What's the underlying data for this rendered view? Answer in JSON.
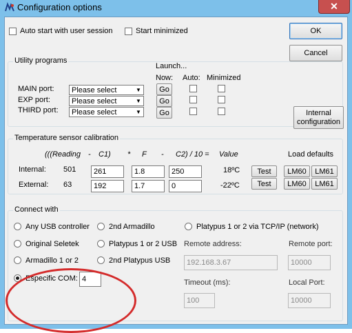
{
  "window": {
    "title": "Configuration options",
    "close_label": "✕"
  },
  "top": {
    "auto_start_label": "Auto start with user session",
    "start_min_label": "Start minimized"
  },
  "buttons": {
    "ok": "OK",
    "cancel": "Cancel",
    "internal_config": [
      "Internal",
      "configuration"
    ]
  },
  "utility": {
    "group_label": "Utility programs",
    "launch_label": "Launch...",
    "now_label": "Now:",
    "auto_label": "Auto:",
    "minimized_label": "Minimized",
    "go_label": "Go",
    "ports": [
      {
        "label": "MAIN port:",
        "value": "Please select"
      },
      {
        "label": "EXP port:",
        "value": "Please select"
      },
      {
        "label": "THIRD port:",
        "value": "Please select"
      }
    ]
  },
  "temperature": {
    "group_label": "Temperature sensor calibration",
    "formula": [
      "(((Reading",
      "-",
      "C1)",
      "*",
      "F",
      "-",
      "C2) / 10 =",
      "Value"
    ],
    "load_defaults_label": "Load defaults",
    "test_label": "Test",
    "rows": [
      {
        "label": "Internal:",
        "reading": "501",
        "c1": "261",
        "f": "1.8",
        "c2": "250",
        "value": "18ºC",
        "preset_a": "LM60",
        "preset_b": "LM61"
      },
      {
        "label": "External:",
        "reading": "63",
        "c1": "192",
        "f": "1.7",
        "c2": "0",
        "value": "-22ºC",
        "preset_a": "LM60",
        "preset_b": "LM61"
      }
    ]
  },
  "connect": {
    "group_label": "Connect with",
    "options": {
      "any_usb": "Any USB controller",
      "armadillo2": "2nd Armadillo",
      "platypus_tcp": "Platypus 1 or 2 via TCP/IP (network)",
      "seletek": "Original Seletek",
      "platypus_usb": "Platypus 1 or 2 USB",
      "armadillo12": "Armadillo 1 or 2",
      "platypus2": "2nd Platypus USB",
      "especific": "Especific COM:"
    },
    "com_value": "4",
    "remote_address_label": "Remote address:",
    "remote_address_value": "192.168.3.67",
    "remote_port_label": "Remote port:",
    "remote_port_value": "10000",
    "timeout_label": "Timeout (ms):",
    "timeout_value": "100",
    "local_port_label": "Local Port:",
    "local_port_value": "10000"
  },
  "colors": {
    "annotation": "#d42b2b",
    "titlebar": "#7dc0ea",
    "close": "#c7504f"
  }
}
